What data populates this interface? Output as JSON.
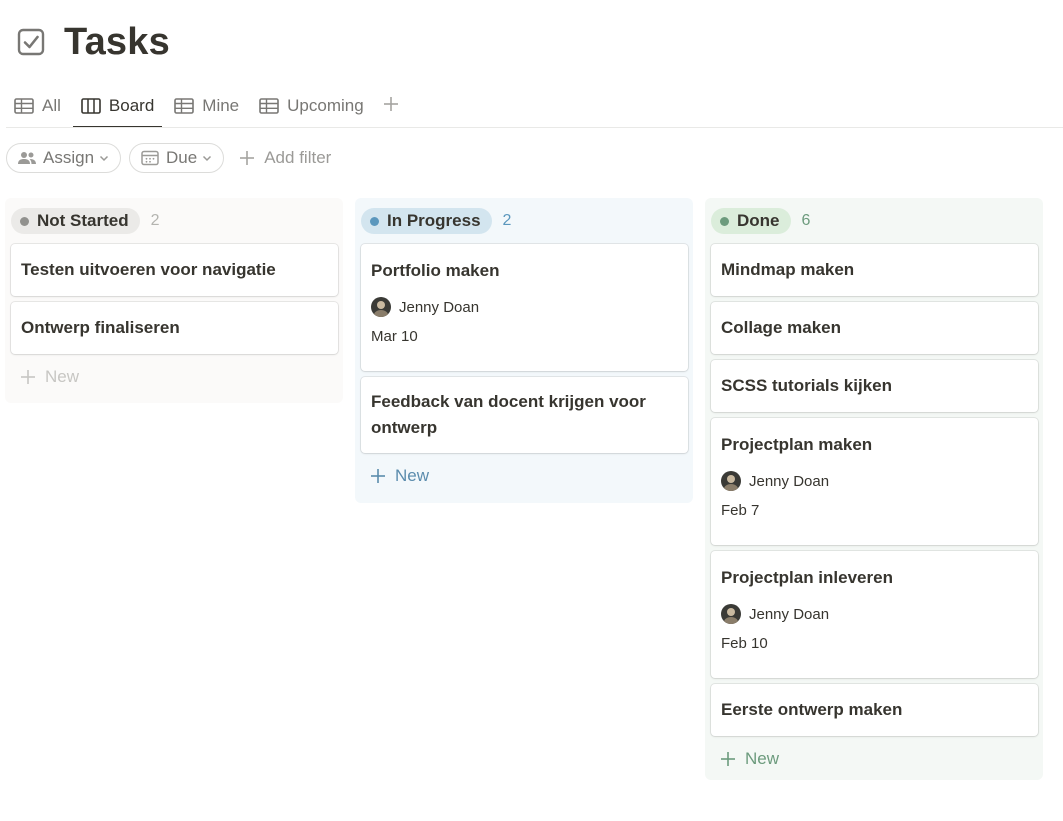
{
  "page": {
    "title": "Tasks",
    "icon": "checkbox-icon"
  },
  "tabs": [
    {
      "label": "All",
      "icon": "table-icon",
      "active": false
    },
    {
      "label": "Board",
      "icon": "board-icon",
      "active": true
    },
    {
      "label": "Mine",
      "icon": "table-icon",
      "active": false
    },
    {
      "label": "Upcoming",
      "icon": "table-icon",
      "active": false
    }
  ],
  "filters": {
    "assign_label": "Assign",
    "due_label": "Due",
    "add_filter_label": "Add filter"
  },
  "columns": [
    {
      "status": "Not Started",
      "count": "2",
      "pill_color": "#ebeae8",
      "dot_color": "#91918e",
      "count_color": "#b4b4b0",
      "new_label": "New",
      "new_color": "#c7c6c3",
      "cards": [
        {
          "title": "Testen uitvoeren voor navigatie"
        },
        {
          "title": "Ontwerp finaliseren"
        }
      ]
    },
    {
      "status": "In Progress",
      "count": "2",
      "pill_color": "#d3e5ef",
      "dot_color": "#5b97bd",
      "count_color": "#5b97bd",
      "new_label": "New",
      "new_color": "#5b8cad",
      "cards": [
        {
          "title": "Portfolio maken",
          "person": "Jenny Doan",
          "date": "Mar 10"
        },
        {
          "title": "Feedback van docent krijgen voor ontwerp"
        }
      ]
    },
    {
      "status": "Done",
      "count": "6",
      "pill_color": "#dbeddb",
      "dot_color": "#6c9b7d",
      "count_color": "#6c9b7d",
      "new_label": "New",
      "new_color": "#6c9b7d",
      "cards": [
        {
          "title": "Mindmap maken"
        },
        {
          "title": "Collage maken"
        },
        {
          "title": "SCSS tutorials kijken"
        },
        {
          "title": "Projectplan maken",
          "person": "Jenny Doan",
          "date": "Feb 7"
        },
        {
          "title": "Projectplan inleveren",
          "person": "Jenny Doan",
          "date": "Feb 10"
        },
        {
          "title": "Eerste ontwerp maken"
        }
      ]
    }
  ]
}
